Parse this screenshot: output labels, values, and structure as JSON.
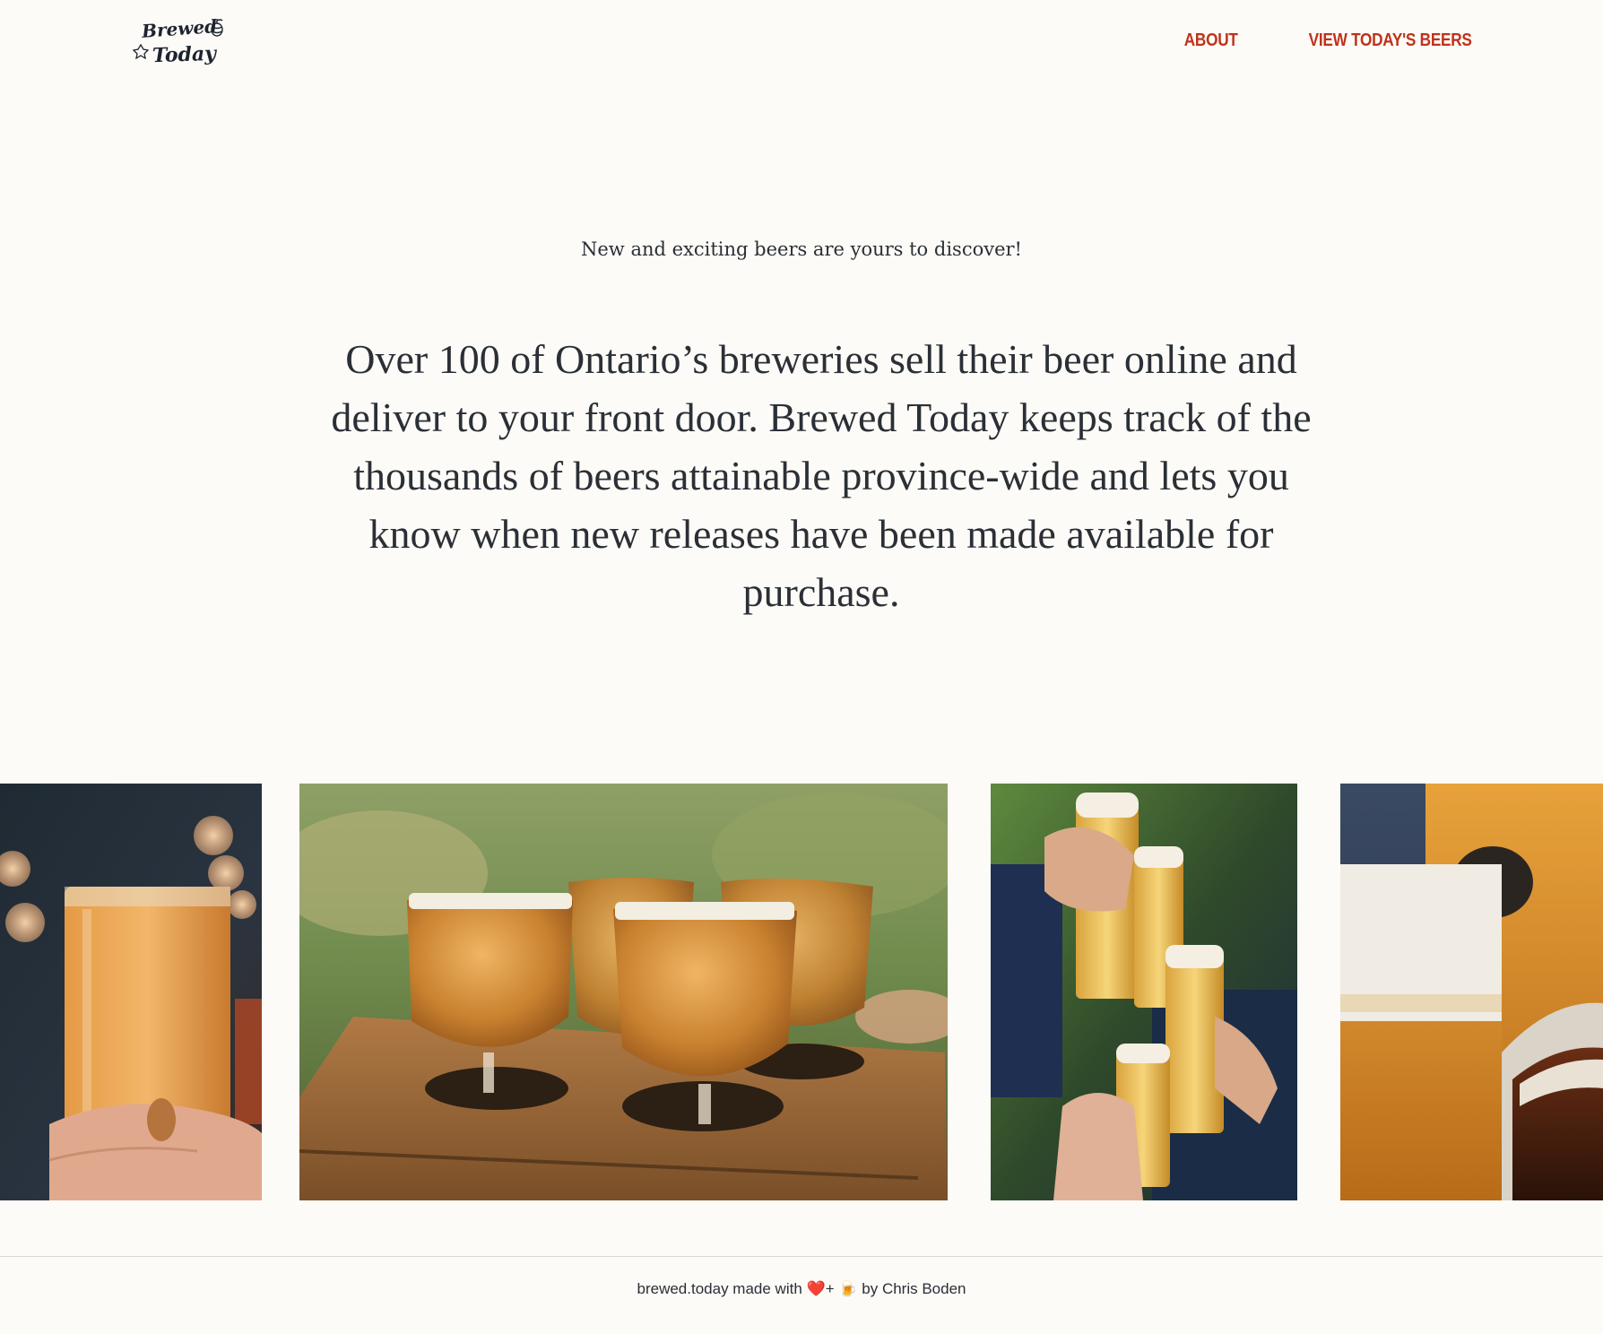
{
  "brand": {
    "logo_line1": "Brewed",
    "logo_line2": "Today",
    "logo_icon": "hop-icon"
  },
  "nav": {
    "items": [
      {
        "label": "ABOUT"
      },
      {
        "label": "VIEW TODAY'S BEERS"
      }
    ]
  },
  "hero": {
    "tagline": "New and exciting beers are yours to discover!",
    "intro": "Over 100 of Ontario’s breweries sell their beer online and deliver to your front door. Brewed Today keeps track of the thousands of beers attainable province-wide and lets you know when new releases have been made available for purchase."
  },
  "gallery": {
    "photos": [
      {
        "subject": "hand-holding-pint-photo"
      },
      {
        "subject": "beer-flight-paddle-photo"
      },
      {
        "subject": "friends-cheers-photo"
      },
      {
        "subject": "beer-glasses-closeup-photo"
      }
    ]
  },
  "footer": {
    "text_before": "brewed.today made with",
    "heart_glyph": "❤️",
    "plus": "+",
    "mug_glyph": "🍺",
    "text_after": "by Chris Boden"
  },
  "colors": {
    "background": "#fcfbf7",
    "accent": "#c0311b",
    "text": "#2b2f36",
    "rule": "#d8d8d4"
  }
}
